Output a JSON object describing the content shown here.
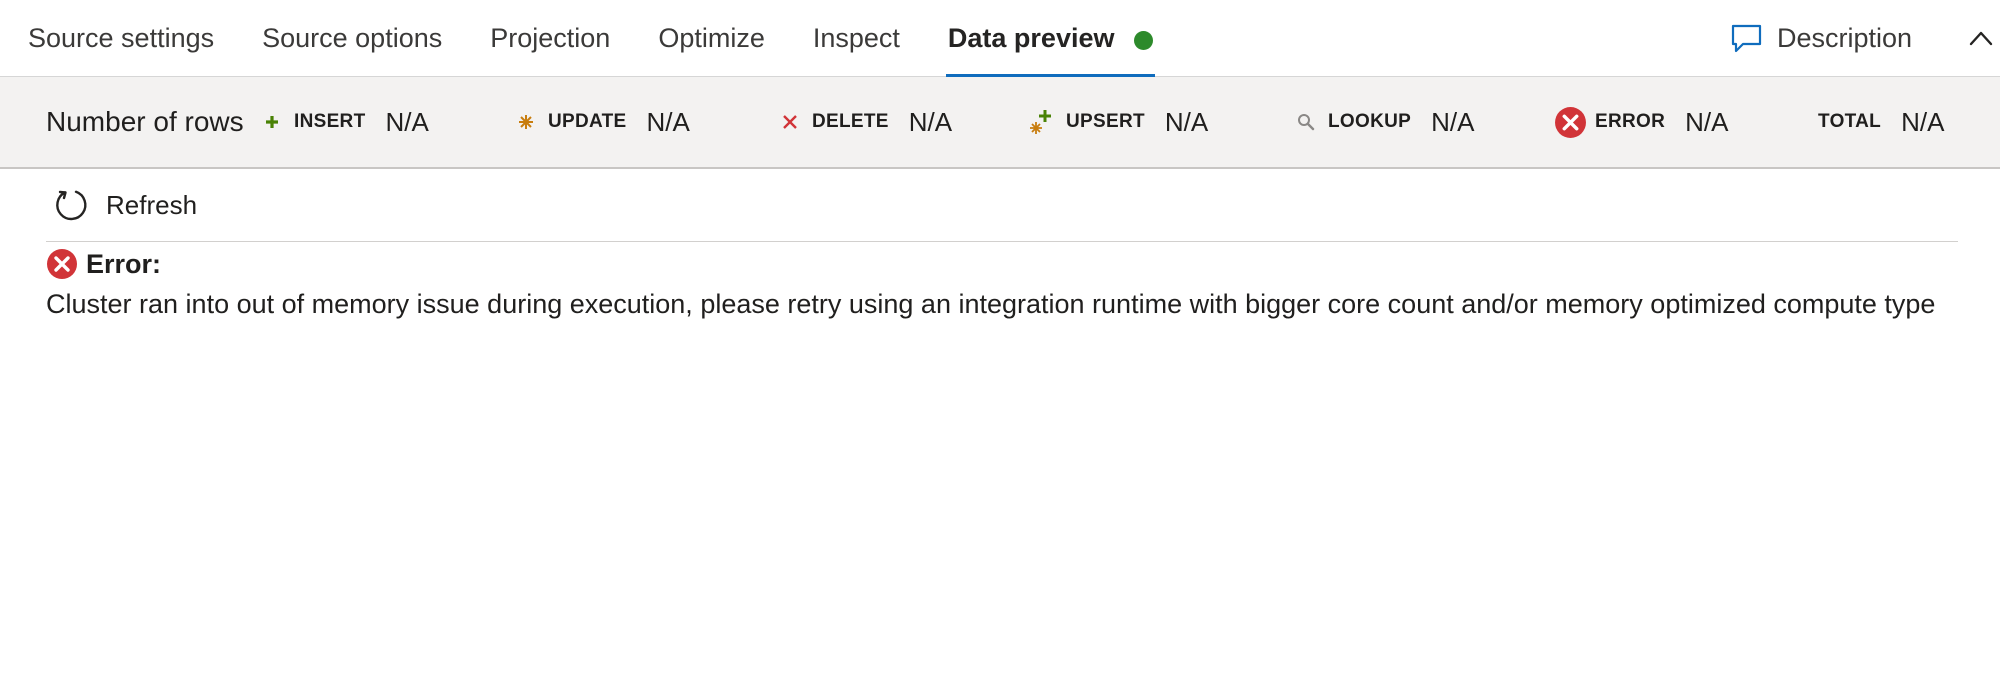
{
  "tabs": [
    {
      "label": "Source settings",
      "active": false
    },
    {
      "label": "Source options",
      "active": false
    },
    {
      "label": "Projection",
      "active": false
    },
    {
      "label": "Optimize",
      "active": false
    },
    {
      "label": "Inspect",
      "active": false
    },
    {
      "label": "Data preview",
      "active": true
    }
  ],
  "status_color": "#2d8a2b",
  "accent_color": "#0f6cbd",
  "description": {
    "label": "Description",
    "icon": "comment-icon"
  },
  "collapse_icon": "chevron-up-icon",
  "stats": {
    "rows_label": "Number of rows",
    "items": [
      {
        "label": "INSERT",
        "value": "N/A",
        "icon": "plus-icon",
        "color": "#498205"
      },
      {
        "label": "UPDATE",
        "value": "N/A",
        "icon": "asterisk-icon",
        "color": "#c87d0e"
      },
      {
        "label": "DELETE",
        "value": "N/A",
        "icon": "x-icon",
        "color": "#d13438"
      },
      {
        "label": "UPSERT",
        "value": "N/A",
        "icon": "upsert-icon",
        "color": "#498205"
      },
      {
        "label": "LOOKUP",
        "value": "N/A",
        "icon": "search-icon",
        "color": "#8a8886"
      },
      {
        "label": "ERROR",
        "value": "N/A",
        "icon": "error-circle-icon",
        "color": "#d13438"
      },
      {
        "label": "TOTAL",
        "value": "N/A",
        "icon": "",
        "color": ""
      }
    ]
  },
  "refresh": {
    "label": "Refresh",
    "icon": "refresh-icon"
  },
  "error": {
    "title": "Error:",
    "icon": "error-circle-icon",
    "message": "Cluster ran into out of memory issue during execution, please retry using an integration runtime with bigger core count and/or memory optimized compute type"
  }
}
